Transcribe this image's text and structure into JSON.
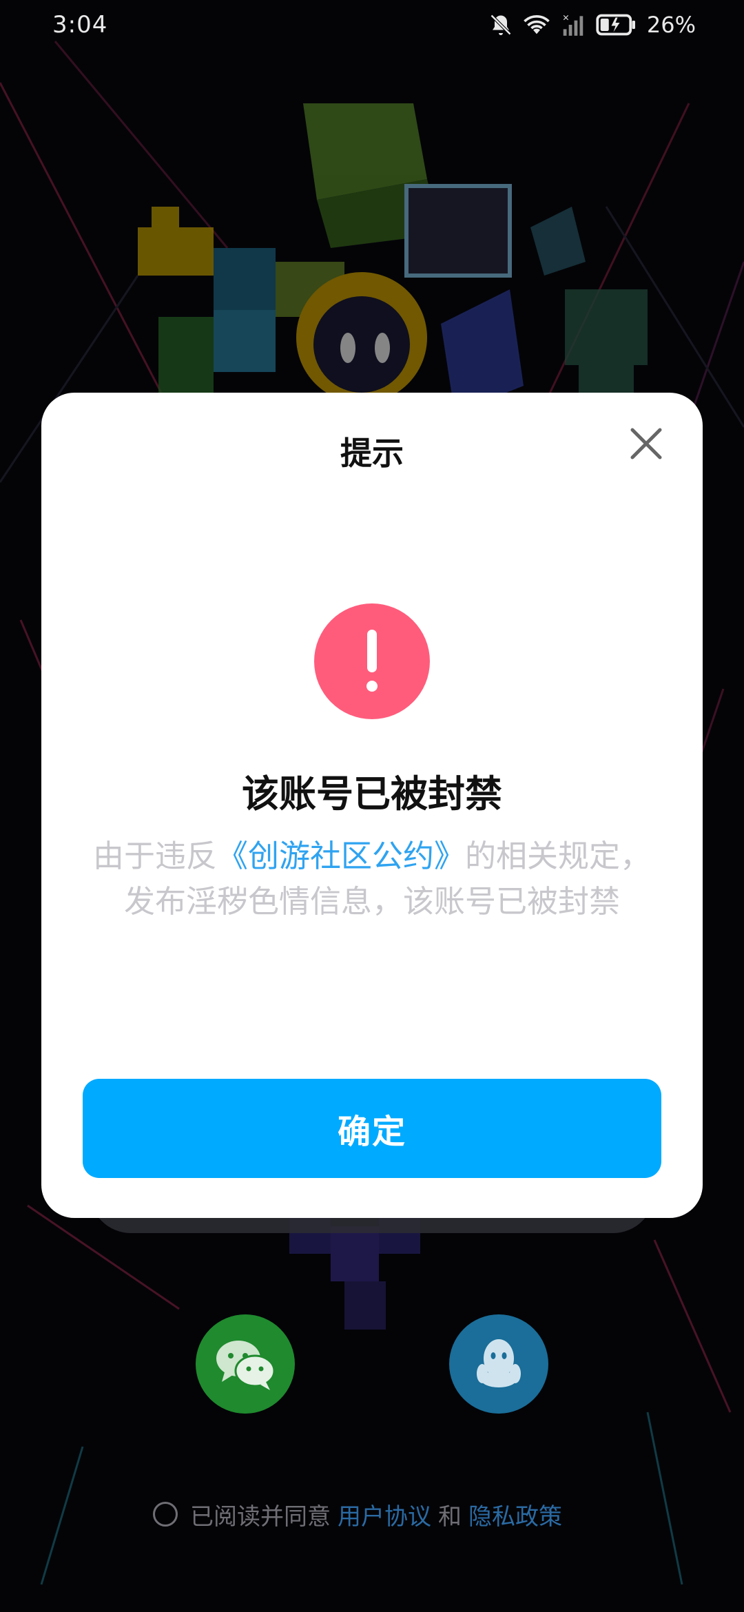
{
  "status_bar": {
    "time": "3:04",
    "battery_percent": "26%",
    "icons": [
      "bell-muted-icon",
      "wifi-icon",
      "signal-icon",
      "battery-charging-icon"
    ]
  },
  "modal": {
    "title": "提示",
    "close_icon": "close-icon",
    "alert_icon": "exclamation-icon",
    "alert_color": "#ff5c7c",
    "heading": "该账号已被封禁",
    "desc_prefix": "由于违反",
    "desc_link": "《创游社区公约》",
    "desc_suffix": "的相关规定，发布淫秽色情信息，该账号已被封禁",
    "confirm_label": "确定",
    "confirm_color": "#00aaff"
  },
  "login": {
    "wechat_icon": "wechat-icon",
    "qq_icon": "qq-icon",
    "agree_text": "已阅读并同意",
    "user_agreement": "用户协议",
    "and_text": "和",
    "privacy_policy": "隐私政策"
  }
}
